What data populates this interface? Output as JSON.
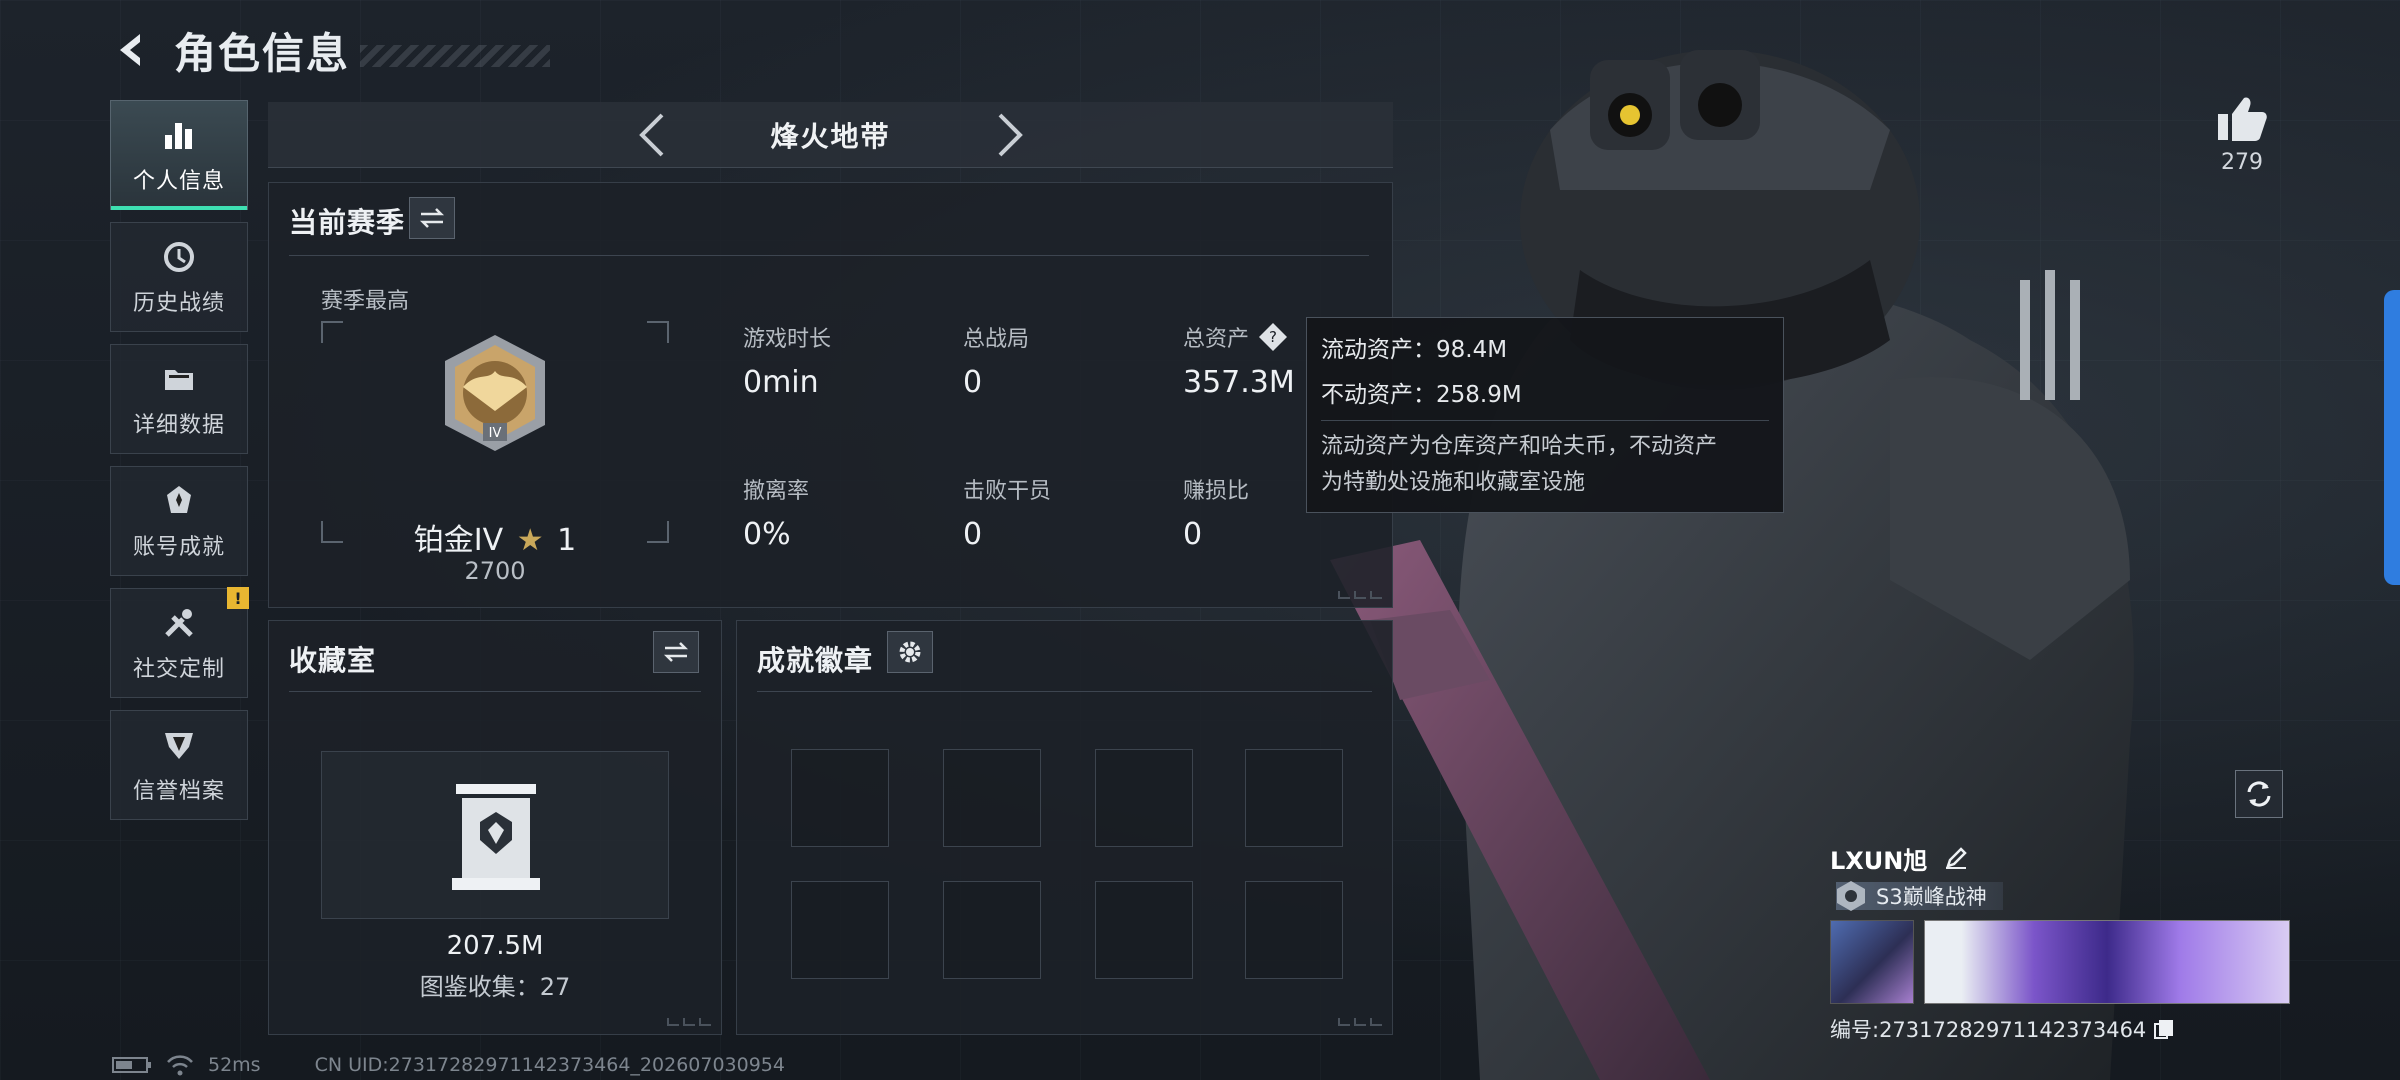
{
  "header": {
    "title": "角色信息"
  },
  "sidebar": {
    "items": [
      {
        "label": "个人信息",
        "icon": "bar-chart-icon",
        "active": true
      },
      {
        "label": "历史战绩",
        "icon": "history-clock-icon",
        "active": false
      },
      {
        "label": "详细数据",
        "icon": "folder-icon",
        "active": false
      },
      {
        "label": "账号成就",
        "icon": "medal-icon",
        "active": false
      },
      {
        "label": "社交定制",
        "icon": "tools-icon",
        "active": false,
        "badge": "!"
      },
      {
        "label": "信誉档案",
        "icon": "shield-icon",
        "active": false
      }
    ]
  },
  "mode": {
    "label": "烽火地带"
  },
  "season": {
    "title": "当前赛季",
    "best_label": "赛季最高",
    "rank_name": "铂金IV",
    "rank_stars": "1",
    "rank_score": "2700",
    "rank_emblem_text": "IV",
    "stats": [
      {
        "label": "游戏时长",
        "value": "0min"
      },
      {
        "label": "总战局",
        "value": "0"
      },
      {
        "label": "总资产",
        "value": "357.3M",
        "help": "?"
      },
      {
        "label": "撤离率",
        "value": "0%"
      },
      {
        "label": "击败干员",
        "value": "0"
      },
      {
        "label": "赚损比",
        "value": "0"
      }
    ]
  },
  "tooltip": {
    "liquid": "流动资产：98.4M",
    "fixed": "不动资产：258.9M",
    "desc1": "流动资产为仓库资产和哈夫币，不动资产",
    "desc2": "为特勤处设施和收藏室设施"
  },
  "collection": {
    "title": "收藏室",
    "value": "207.5M",
    "count": "图鉴收集：27"
  },
  "achievements": {
    "title": "成就徽章",
    "slots": 8
  },
  "like": {
    "count": "279"
  },
  "player": {
    "name": "LXUN旭",
    "title": "S3巅峰战神",
    "id_text": "编号:27317282971142373464"
  },
  "status": {
    "ping": "52ms",
    "uid": "CN UID:27317282971142373464_202607030954"
  },
  "colors": {
    "accent": "#3ee0b2",
    "warn": "#e8b631",
    "side_tab": "#2f7de0"
  }
}
